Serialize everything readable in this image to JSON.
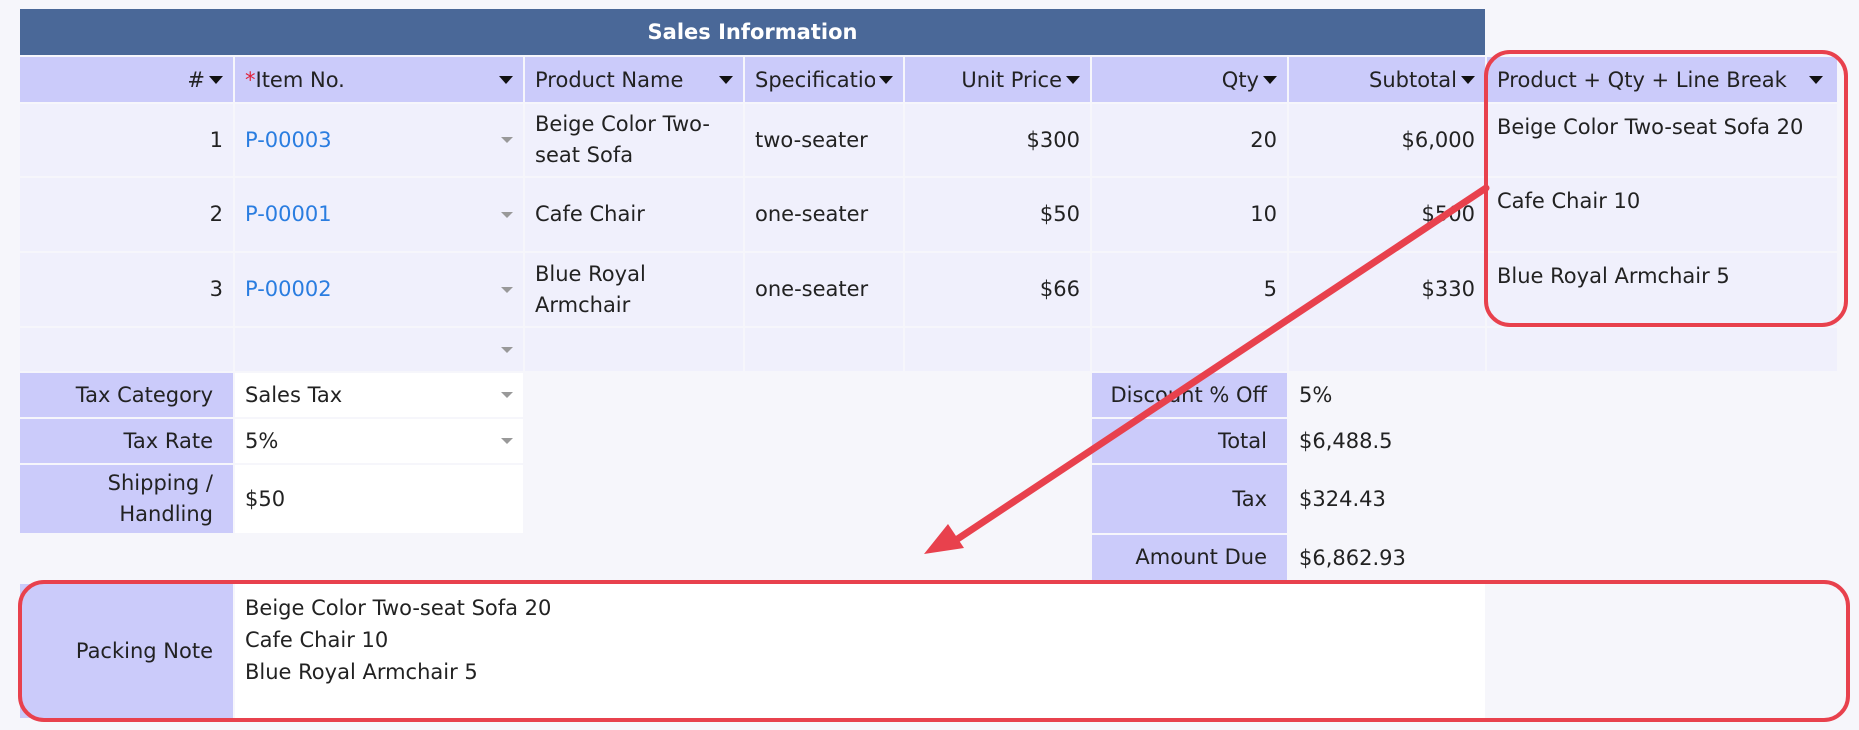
{
  "section_title": "Sales Information",
  "columns": [
    {
      "label": "#"
    },
    {
      "label": "Item No.",
      "required": "*"
    },
    {
      "label": "Product Name"
    },
    {
      "label": "Specification"
    },
    {
      "label": "Unit Price"
    },
    {
      "label": "Qty"
    },
    {
      "label": "Subtotal"
    },
    {
      "label": "Product + Qty + Line Break"
    }
  ],
  "rows": [
    {
      "num": "1",
      "item": "P-00003",
      "name": "Beige Color Two-seat Sofa",
      "spec": "two-seater",
      "price": "$300",
      "qty": "20",
      "subtotal": "$6,000",
      "combo": "Beige Color Two-seat Sofa 20"
    },
    {
      "num": "2",
      "item": "P-00001",
      "name": "Cafe Chair",
      "spec": "one-seater",
      "price": "$50",
      "qty": "10",
      "subtotal": "$500",
      "combo": "Cafe Chair 10"
    },
    {
      "num": "3",
      "item": "P-00002",
      "name": "Blue Royal Armchair",
      "spec": "one-seater",
      "price": "$66",
      "qty": "5",
      "subtotal": "$330",
      "combo": "Blue Royal Armchair 5"
    }
  ],
  "left_fields": {
    "tax_category": {
      "label": "Tax Category",
      "value": "Sales Tax"
    },
    "tax_rate": {
      "label": "Tax Rate",
      "value": "5%"
    },
    "shipping": {
      "label": "Shipping / Handling",
      "value": "$50"
    }
  },
  "right_fields": {
    "discount": {
      "label": "Discount % Off",
      "value": "5%"
    },
    "total": {
      "label": "Total",
      "value": "$6,488.5"
    },
    "tax": {
      "label": "Tax",
      "value": "$324.43"
    },
    "amount_due": {
      "label": "Amount Due",
      "value": "$6,862.93"
    }
  },
  "packing_note": {
    "label": "Packing Note",
    "lines": [
      "Beige Color Two-seat Sofa 20",
      "Cafe Chair 10",
      "Blue Royal Armchair 5"
    ]
  },
  "colors": {
    "header": "#4a6898",
    "label_bg": "#cbcbfa",
    "cell_bg": "#f0f0fc",
    "link": "#2a7de0",
    "annotation": "#e8414d"
  }
}
